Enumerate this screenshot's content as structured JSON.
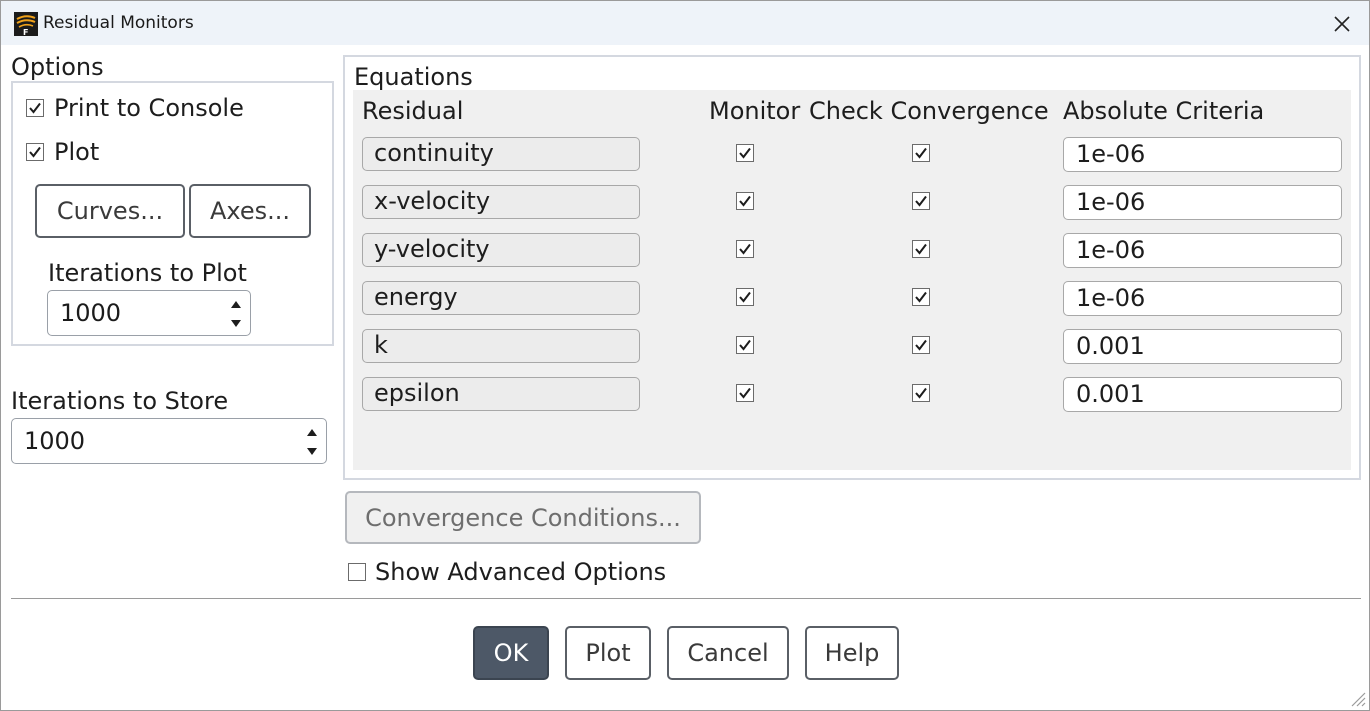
{
  "window": {
    "title": "Residual Monitors"
  },
  "options": {
    "group_label": "Options",
    "print_to_console": {
      "label": "Print to Console",
      "checked": true
    },
    "plot": {
      "label": "Plot",
      "checked": true
    },
    "curves_button": "Curves...",
    "axes_button": "Axes...",
    "iterations_to_plot": {
      "label": "Iterations to Plot",
      "value": "1000"
    }
  },
  "iterations_to_store": {
    "label": "Iterations to Store",
    "value": "1000"
  },
  "equations": {
    "group_label": "Equations",
    "headers": {
      "residual": "Residual",
      "monitor": "Monitor",
      "check_convergence": "Check Convergence",
      "absolute_criteria": "Absolute Criteria"
    },
    "rows": [
      {
        "name": "continuity",
        "monitor": true,
        "check": true,
        "criteria": "1e-06"
      },
      {
        "name": "x-velocity",
        "monitor": true,
        "check": true,
        "criteria": "1e-06"
      },
      {
        "name": "y-velocity",
        "monitor": true,
        "check": true,
        "criteria": "1e-06"
      },
      {
        "name": "energy",
        "monitor": true,
        "check": true,
        "criteria": "1e-06"
      },
      {
        "name": "k",
        "monitor": true,
        "check": true,
        "criteria": "0.001"
      },
      {
        "name": "epsilon",
        "monitor": true,
        "check": true,
        "criteria": "0.001"
      }
    ]
  },
  "convergence_conditions_button": "Convergence Conditions...",
  "show_advanced_options": {
    "label": "Show Advanced Options",
    "checked": false
  },
  "footer": {
    "ok": "OK",
    "plot": "Plot",
    "cancel": "Cancel",
    "help": "Help"
  },
  "colors": {
    "primary_button": "#4d5867",
    "titlebar": "#eef3f9",
    "panel": "#f0f0f0"
  },
  "icons": {
    "app": "fluent-app-icon",
    "close": "close-icon"
  }
}
